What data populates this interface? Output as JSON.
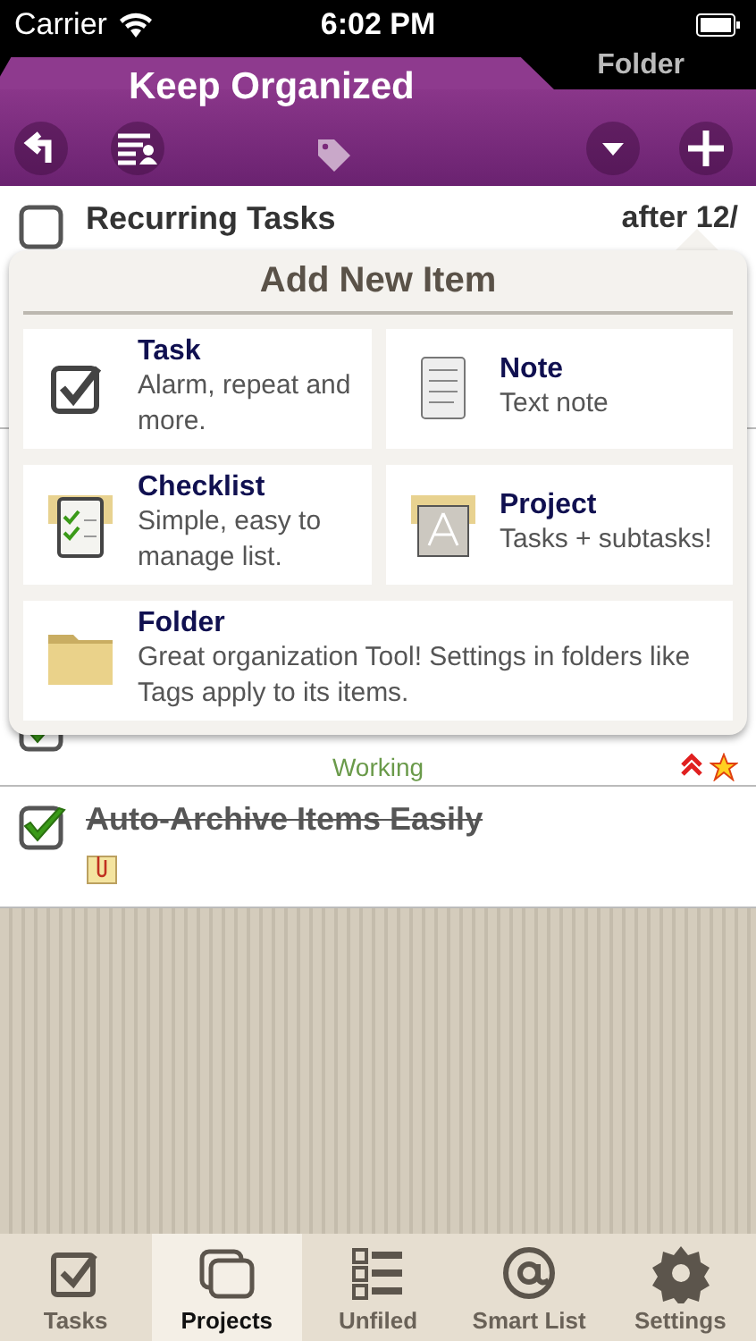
{
  "status_bar": {
    "carrier": "Carrier",
    "time": "6:02 PM"
  },
  "header": {
    "title": "Keep Organized",
    "parent_tab": "Folder"
  },
  "rows": [
    {
      "title": "Recurring Tasks",
      "date": "after 12/",
      "checked": false
    },
    {
      "checked": true,
      "status": "Working",
      "high_priority": true,
      "starred": true
    },
    {
      "title": "Auto-Archive Items Easily",
      "checked": true,
      "has_note": true
    }
  ],
  "popup": {
    "title": "Add New Item",
    "items": [
      {
        "kind": "task",
        "title": "Task",
        "description": "Alarm, repeat and more."
      },
      {
        "kind": "note",
        "title": "Note",
        "description": "Text note"
      },
      {
        "kind": "checklist",
        "title": "Checklist",
        "description": "Simple, easy to manage list."
      },
      {
        "kind": "project",
        "title": "Project",
        "description": "Tasks + subtasks!"
      },
      {
        "kind": "folder",
        "title": "Folder",
        "description": "Great organization Tool! Settings in folders like Tags apply to its items."
      }
    ]
  },
  "tabs": [
    {
      "kind": "tasks",
      "label": "Tasks",
      "selected": false
    },
    {
      "kind": "projects",
      "label": "Projects",
      "selected": true
    },
    {
      "kind": "unfiled",
      "label": "Unfiled",
      "selected": false
    },
    {
      "kind": "smart",
      "label": "Smart List",
      "selected": false
    },
    {
      "kind": "settings",
      "label": "Settings",
      "selected": false
    }
  ]
}
